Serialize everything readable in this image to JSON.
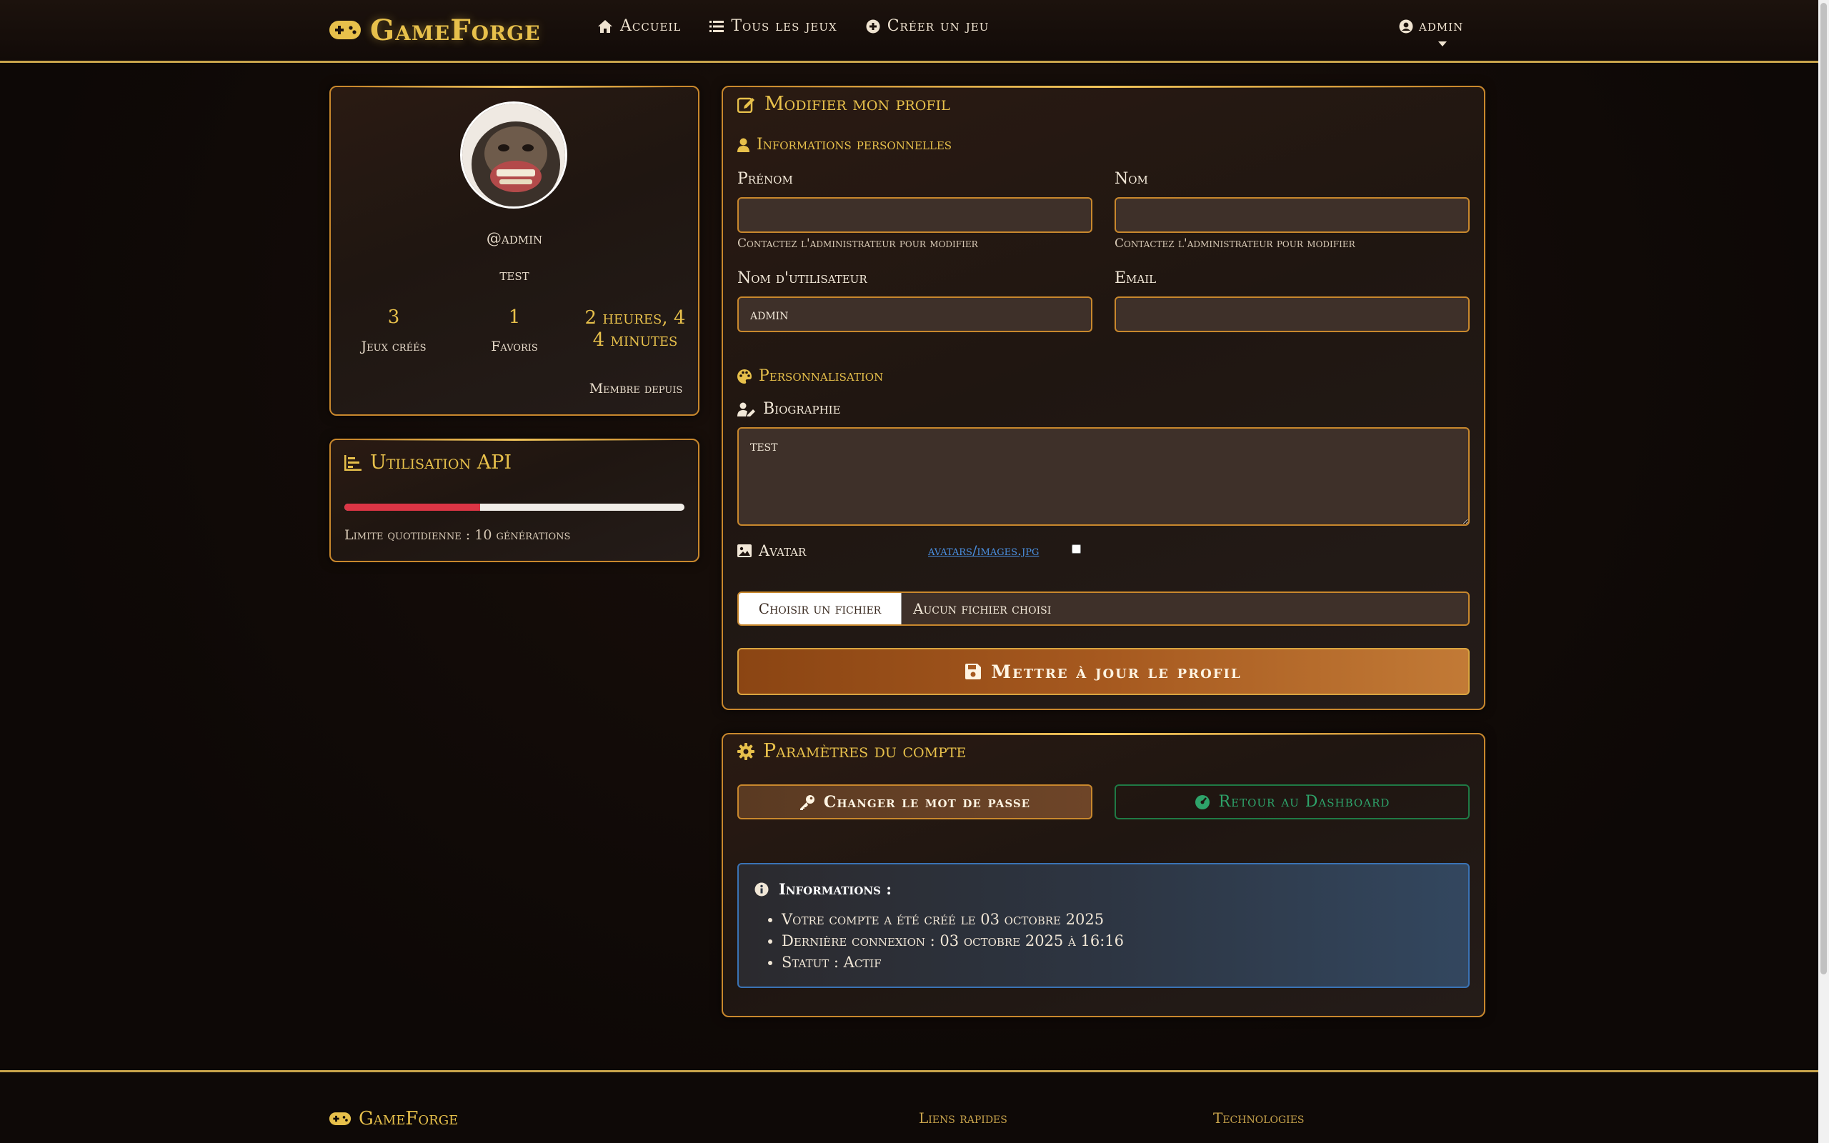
{
  "nav": {
    "brand": "GameForge",
    "links": [
      "Accueil",
      "Tous les jeux",
      "Créer un jeu"
    ],
    "user": "admin"
  },
  "profile": {
    "username": "@admin",
    "bio": "test",
    "stats": [
      {
        "value": "3",
        "label": "Jeux créés"
      },
      {
        "value": "1",
        "label": "Favoris"
      },
      {
        "value": "2 heures, 44 minutes",
        "label": "Membre depuis"
      }
    ]
  },
  "api": {
    "title": "Utilisation API",
    "progress_fraction": 0.4,
    "limit_text": "Limite quotidienne : 10 générations"
  },
  "edit": {
    "title": "Modifier mon profil",
    "personal_section": "Informations personnelles",
    "first_name_label": "Prénom",
    "last_name_label": "Nom",
    "first_name_value": "",
    "last_name_value": "",
    "contact_help": "Contactez l'administrateur pour modifier",
    "username_label": "Nom d'utilisateur",
    "username_value": "admin",
    "email_label": "Email",
    "email_value": "",
    "custom_section": "Personnalisation",
    "bio_label": "Biographie",
    "bio_value": "test",
    "avatar_label": "Avatar",
    "avatar_link": "avatars/images.jpg",
    "file_button": "Choisir un fichier",
    "file_none": "Aucun fichier choisi",
    "submit": "Mettre à jour le profil"
  },
  "account": {
    "title": "Paramètres du compte",
    "change_password": "Changer le mot de passe",
    "back_dashboard": "Retour au Dashboard",
    "info_title": "Informations :",
    "info_items": [
      "Votre compte a été créé le 03 octobre 2025",
      "Dernière connexion : 03 octobre 2025 à 16:16",
      "Statut : Actif"
    ]
  },
  "footer": {
    "brand": "GameForge",
    "quick_links": "Liens rapides",
    "technologies": "Technologies"
  },
  "colors": {
    "gold": "#e7c04b",
    "border": "#c9882d",
    "danger": "#dc3545",
    "success": "#2ea36a",
    "info": "#3a73b5"
  }
}
